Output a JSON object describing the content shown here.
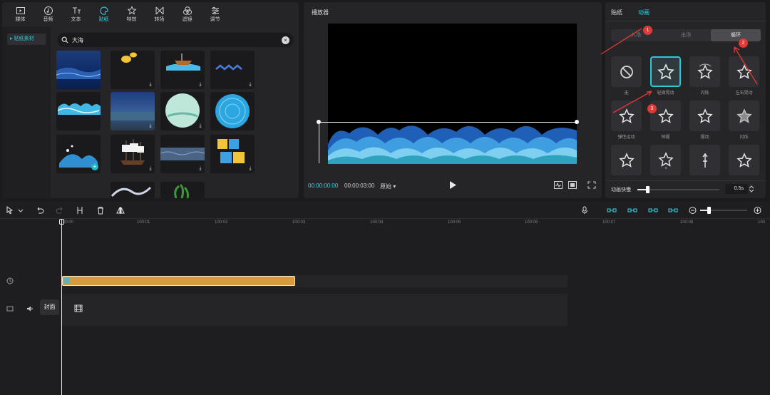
{
  "toolbar": {
    "items": [
      {
        "label": "媒体",
        "icon": "media-icon"
      },
      {
        "label": "音频",
        "icon": "audio-icon"
      },
      {
        "label": "文本",
        "icon": "text-icon"
      },
      {
        "label": "贴纸",
        "icon": "sticker-icon",
        "active": true
      },
      {
        "label": "特效",
        "icon": "effects-icon"
      },
      {
        "label": "转场",
        "icon": "transition-icon"
      },
      {
        "label": "滤镜",
        "icon": "filter-icon"
      },
      {
        "label": "调节",
        "icon": "adjust-icon"
      }
    ]
  },
  "media_sidebar": {
    "item": "贴纸素材"
  },
  "search": {
    "value": "大海"
  },
  "player": {
    "title": "播放器",
    "current_time": "00:00:00:00",
    "total_time": "00:00:03:00",
    "ratio_label": "原始"
  },
  "properties": {
    "tabs": [
      "贴纸",
      "动画"
    ],
    "active_tab": "动画",
    "segments": [
      "入场",
      "出场",
      "循环"
    ],
    "active_segment": "循环",
    "animations": [
      {
        "label": "无"
      },
      {
        "label": "轻微晃动"
      },
      {
        "label": "闪烁"
      },
      {
        "label": "左右晃动"
      },
      {
        "label": "弹性运动"
      },
      {
        "label": "钟摆"
      },
      {
        "label": "摆动"
      },
      {
        "label": "闪烁"
      },
      {
        "label": ""
      },
      {
        "label": ""
      },
      {
        "label": ""
      },
      {
        "label": ""
      }
    ],
    "selected_animation": 1,
    "speed_label": "动画快慢",
    "speed_value": "0.5s",
    "speed_fraction": 0.12
  },
  "annotations": [
    "1",
    "2",
    "3"
  ],
  "timeline": {
    "ticks": [
      "00:00",
      "100:01",
      "100:02",
      "100:03",
      "100:04",
      "100:05",
      "100:06",
      "100:07",
      "100:08",
      "100"
    ],
    "cover_label": "封面"
  },
  "colors": {
    "accent": "#2fd6e6",
    "clip": "#d59b3c",
    "annotation": "#e03a36"
  }
}
